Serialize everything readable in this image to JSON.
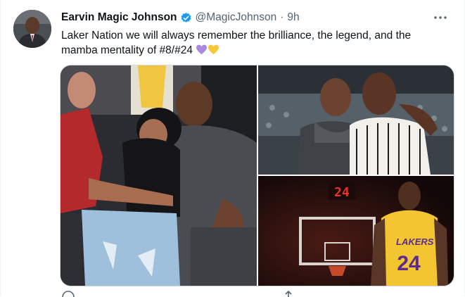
{
  "tweet": {
    "author_name": "Earvin Magic Johnson",
    "handle": "@MagicJohnson",
    "separator": "·",
    "time": "9h",
    "more_icon": "more-horizontal-icon",
    "text": "Laker Nation we will always remember the brilliance, the legend, and the mamba mentality of #8/#24",
    "emojis": [
      "purple-heart",
      "yellow-heart"
    ]
  },
  "media": {
    "photo3_scoreboard": "24",
    "photo3_jersey_text": "LAKERS",
    "photo3_jersey_number": "24"
  },
  "colors": {
    "verified_blue": "#1d9bf0",
    "text_primary": "#0f1419",
    "text_secondary": "#536471",
    "purple_heart": "#a98ae0",
    "yellow_heart": "#f7c93a"
  }
}
